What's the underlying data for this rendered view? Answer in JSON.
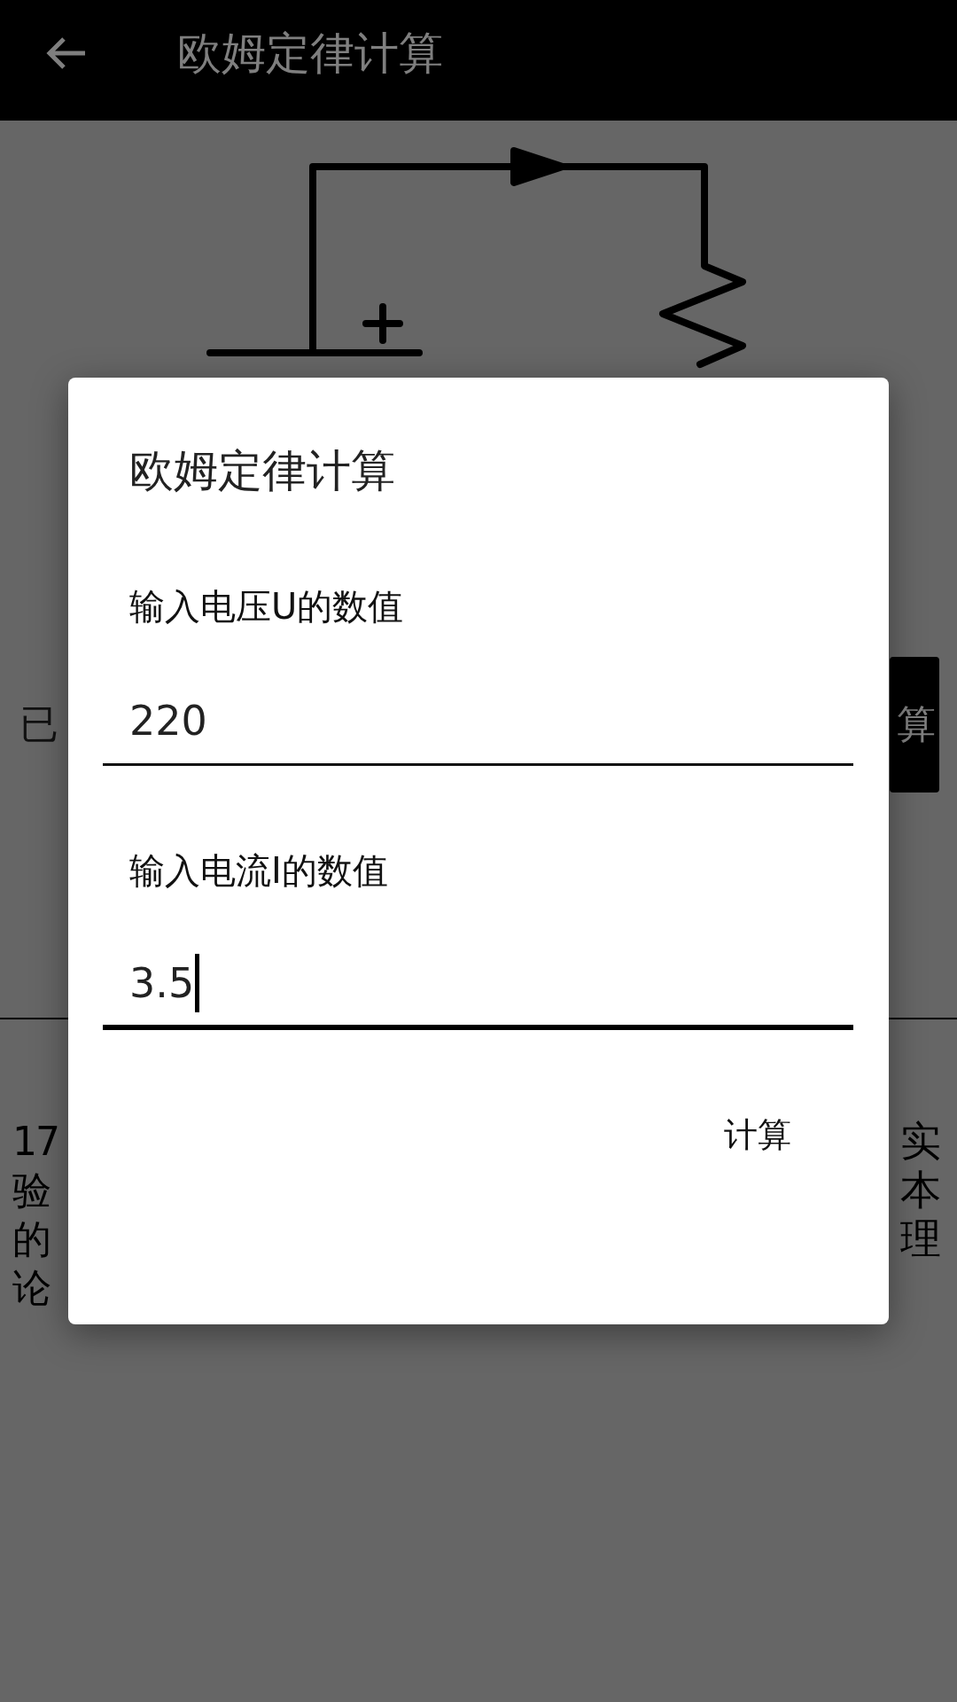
{
  "app_bar": {
    "title": "欧姆定律计算"
  },
  "background": {
    "label_fragment": "已",
    "button_fragment": "算",
    "paragraph_left_lines": [
      "17",
      "验",
      "的",
      "论"
    ],
    "paragraph_right_lines": [
      "实",
      "本",
      "理"
    ]
  },
  "dialog": {
    "title": "欧姆定律计算",
    "fields": [
      {
        "label": "输入电压U的数值",
        "value": "220",
        "focused": false
      },
      {
        "label": "输入电流I的数值",
        "value": "3.5",
        "focused": true
      }
    ],
    "button": "计算"
  }
}
